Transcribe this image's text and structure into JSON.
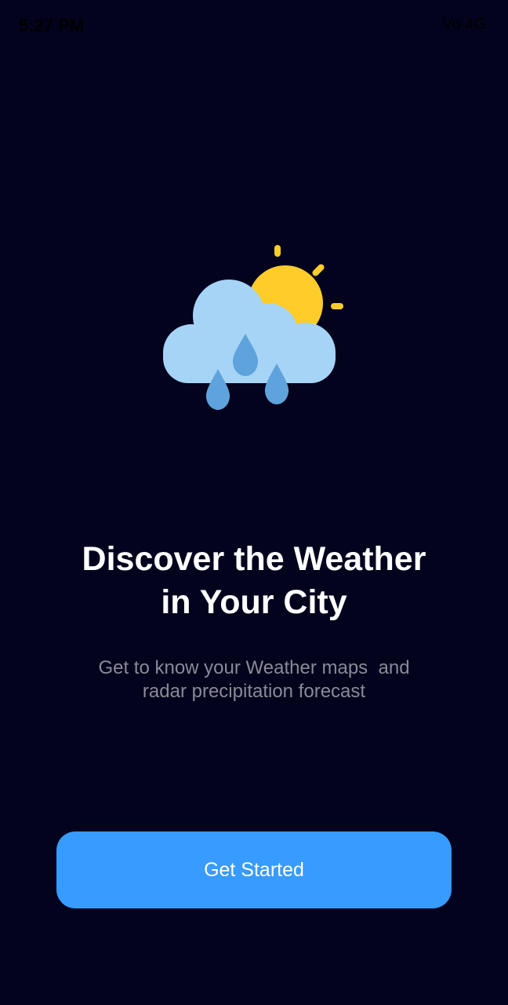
{
  "status_bar": {
    "time": "5:27 PM",
    "indicators": "Vo 4G"
  },
  "illustration": {
    "icon": "sun-cloud-rain-icon",
    "colors": {
      "sun": "#ffcc29",
      "cloud": "#a6d4f7",
      "drops": "#5fa3dc"
    }
  },
  "headline": {
    "line1": "Discover the Weather",
    "line2": "in Your City"
  },
  "subtitle": {
    "line1": "Get to know your Weather maps  and",
    "line2": "radar precipitation forecast"
  },
  "cta": {
    "label": "Get Started",
    "color": "#379bff"
  },
  "theme": {
    "background": "#03031e",
    "text": "#ffffff",
    "muted_text": "#8a8a96"
  }
}
